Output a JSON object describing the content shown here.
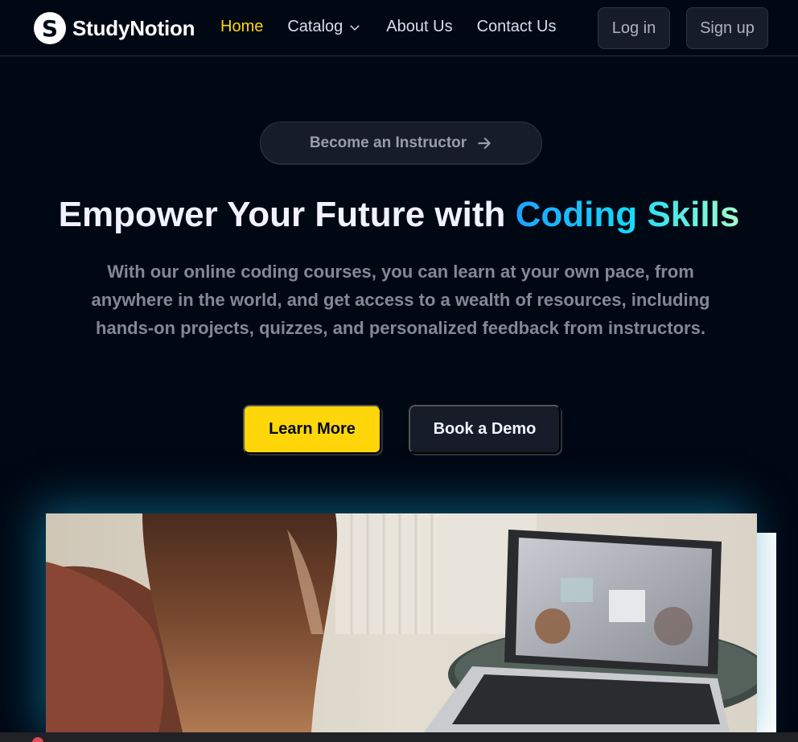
{
  "nav": {
    "logo_letter": "S",
    "logo_text": "StudyNotion",
    "links": [
      {
        "label": "Home",
        "active": true
      },
      {
        "label": "Catalog",
        "has_dropdown": true
      },
      {
        "label": "About Us"
      },
      {
        "label": "Contact Us"
      }
    ],
    "login_label": "Log in",
    "signup_label": "Sign up"
  },
  "hero": {
    "instructor_label": "Become an Instructor",
    "title_prefix": "Empower Your Future with ",
    "title_highlight": "Coding Skills",
    "subtitle": "With our online coding courses, you can learn at your own pace, from anywhere in the world, and get access to a wealth of resources, including hands-on projects, quizzes, and personalized feedback from instructors.",
    "learn_more_label": "Learn More",
    "book_demo_label": "Book a Demo"
  },
  "colors": {
    "background": "#000814",
    "accent_yellow": "#ffd60a",
    "surface": "#161d29",
    "muted_text": "#838894",
    "gradient": [
      "#1fa2ff",
      "#12d8fa",
      "#a6ffcb"
    ]
  },
  "icons": {
    "catalog_dropdown": "chevron-down-icon",
    "instructor_arrow": "arrow-right-icon"
  }
}
